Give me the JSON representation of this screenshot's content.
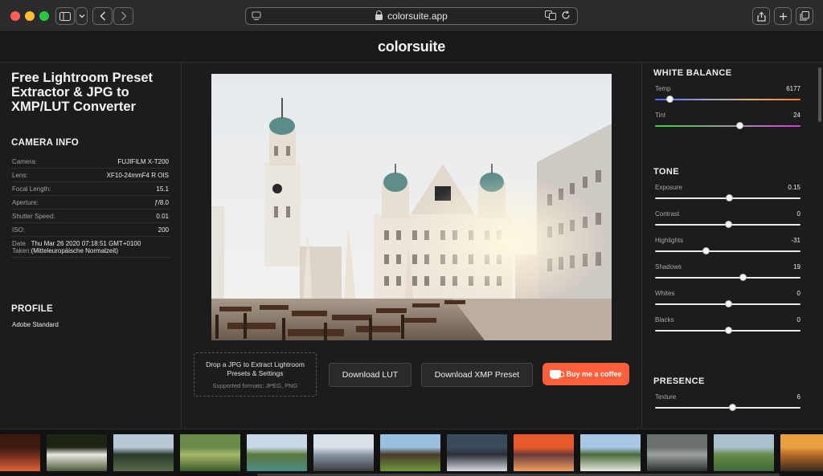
{
  "browser": {
    "url": "colorsuite.app",
    "icons": [
      "sidebar-icon",
      "chevron-down-icon",
      "back-icon",
      "forward-icon",
      "reader-icon",
      "lock-icon",
      "translate-icon",
      "reload-icon",
      "share-icon",
      "new-tab-icon",
      "tabs-icon"
    ]
  },
  "site": {
    "logo": "colorsuite"
  },
  "left": {
    "title": "Free Lightroom Preset Extractor & JPG to XMP/LUT Converter",
    "camera_info": {
      "heading": "CAMERA INFO",
      "rows": [
        {
          "k": "Camera:",
          "v": "FUJIFILM X-T200"
        },
        {
          "k": "Lens:",
          "v": "XF10-24mmF4 R OIS"
        },
        {
          "k": "Focal Length:",
          "v": "15.1"
        },
        {
          "k": "Aperture:",
          "v": "ƒ/8.0"
        },
        {
          "k": "Shutter Speed:",
          "v": "0.01"
        },
        {
          "k": "ISO:",
          "v": "200"
        }
      ],
      "date_label": "Date Taken:",
      "date_value": "Thu Mar 26 2020 07:18:51 GMT+0100 (Mitteleuropäische Normalzeit)"
    },
    "profile": {
      "heading": "PROFILE",
      "value": "Adobe Standard"
    }
  },
  "center": {
    "dropzone_main": "Drop a JPG to Extract Lightroom Presets & Settings",
    "dropzone_sub": "Supported formats: JPEG, PNG",
    "download_lut": "Download LUT",
    "download_xmp": "Download XMP Preset",
    "coffee": "Buy me a coffee"
  },
  "right": {
    "white_balance": {
      "heading": "WHITE BALANCE",
      "sliders": [
        {
          "label": "Temp",
          "value": "6177",
          "position": 0.1,
          "track": "temp"
        },
        {
          "label": "Tint",
          "value": "24",
          "position": 0.58,
          "track": "tint"
        }
      ]
    },
    "tone": {
      "heading": "TONE",
      "sliders": [
        {
          "label": "Exposure",
          "value": "0.15",
          "position": 0.51
        },
        {
          "label": "Contrast",
          "value": "0",
          "position": 0.5
        },
        {
          "label": "Highlights",
          "value": "-31",
          "position": 0.35
        },
        {
          "label": "Shadows",
          "value": "19",
          "position": 0.6
        },
        {
          "label": "Whites",
          "value": "0",
          "position": 0.5
        },
        {
          "label": "Blacks",
          "value": "0",
          "position": 0.5
        }
      ]
    },
    "presence": {
      "heading": "PRESENCE",
      "sliders": [
        {
          "label": "Texture",
          "value": "6",
          "position": 0.53
        }
      ]
    }
  },
  "filmstrip": {
    "thumbnails": [
      {
        "name": "market-lights-thumbnail",
        "colors": [
          "#3b1a10",
          "#e0643a",
          "#6a2a1a"
        ]
      },
      {
        "name": "lemur-thumbnail",
        "colors": [
          "#1c2414",
          "#4a5a3a",
          "#e8e8e0"
        ]
      },
      {
        "name": "mountain-valley-thumbnail",
        "colors": [
          "#b8c8d8",
          "#5a6a4a",
          "#2a3a2a"
        ]
      },
      {
        "name": "green-hills-thumbnail",
        "colors": [
          "#6a8a4a",
          "#3a5a2a",
          "#a8b868"
        ]
      },
      {
        "name": "alpine-lake-thumbnail",
        "colors": [
          "#c8d8e8",
          "#4a8a8a",
          "#5a7a3a"
        ]
      },
      {
        "name": "snowy-village-thumbnail",
        "colors": [
          "#d8e0e8",
          "#3a3a3a",
          "#8a98a8"
        ]
      },
      {
        "name": "cow-meadow-thumbnail",
        "colors": [
          "#9ac0e0",
          "#6a9a3a",
          "#4a3a2a"
        ]
      },
      {
        "name": "snow-peak-thumbnail",
        "colors": [
          "#3a4a5a",
          "#d8dce0",
          "#2a3038"
        ]
      },
      {
        "name": "sunset-street-thumbnail",
        "colors": [
          "#e85a2a",
          "#f0a060",
          "#6a3a3a"
        ]
      },
      {
        "name": "white-house-thumbnail",
        "colors": [
          "#a8c8e8",
          "#e8e8e0",
          "#4a6a3a"
        ]
      },
      {
        "name": "misty-mountain-thumbnail",
        "colors": [
          "#6a7070",
          "#2a3030",
          "#9aa0a0"
        ]
      },
      {
        "name": "green-ridge-thumbnail",
        "colors": [
          "#a8c0d0",
          "#3a6a3a",
          "#6a8a4a"
        ]
      },
      {
        "name": "golden-street-thumbnail",
        "colors": [
          "#e8a040",
          "#3a2a1a",
          "#b86a2a"
        ]
      }
    ]
  }
}
